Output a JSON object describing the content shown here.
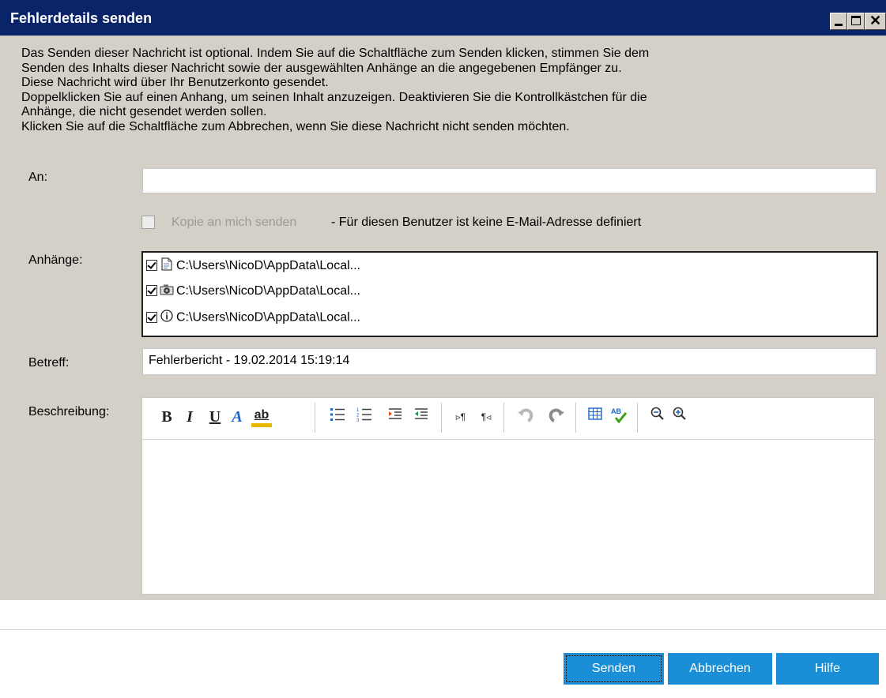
{
  "window": {
    "title": "Fehlerdetails senden",
    "minimize_icon": "minimize-icon",
    "maximize_icon": "maximize-icon",
    "close_icon": "close-icon"
  },
  "intro": {
    "line1": "Das Senden dieser Nachricht ist optional. Indem Sie auf die Schaltfläche zum Senden klicken, stimmen Sie dem",
    "line2": "Senden des Inhalts dieser Nachricht sowie der ausgewählten Anhänge an die angegebenen Empfänger zu.",
    "line3": "Diese Nachricht wird über Ihr Benutzerkonto gesendet.",
    "line4": "Doppelklicken Sie auf einen Anhang, um seinen Inhalt anzuzeigen. Deaktivieren Sie die Kontrollkästchen für die",
    "line5": "Anhänge, die nicht gesendet werden sollen.",
    "line6": "Klicken Sie auf die Schaltfläche zum Abbrechen, wenn Sie diese Nachricht nicht senden möchten."
  },
  "form": {
    "to_label": "An:",
    "to_value": "",
    "cc_label": "Kopie an mich senden",
    "cc_checked": false,
    "cc_note": "- Für diesen Benutzer ist keine E-Mail-Adresse definiert",
    "attachments_label": "Anhänge:",
    "attachments": [
      {
        "checked": true,
        "icon": "document-icon",
        "path": "C:\\Users\\NicoD\\AppData\\Local..."
      },
      {
        "checked": true,
        "icon": "camera-icon",
        "path": "C:\\Users\\NicoD\\AppData\\Local..."
      },
      {
        "checked": true,
        "icon": "info-icon",
        "path": "C:\\Users\\NicoD\\AppData\\Local..."
      }
    ],
    "subject_label": "Betreff:",
    "subject_value": "Fehlerbericht - 19.02.2014 15:19:14",
    "description_label": "Beschreibung:",
    "description_value": ""
  },
  "toolbar": {
    "bold": "B",
    "italic": "I",
    "underline": "U",
    "font_color": "A",
    "highlight": "ab",
    "icons": [
      "bullet-list-icon",
      "numbered-list-icon",
      "indent-icon",
      "outdent-icon",
      "ltr-icon",
      "rtl-icon",
      "undo-icon",
      "redo-icon",
      "table-icon",
      "spellcheck-icon",
      "zoom-out-icon",
      "zoom-in-icon"
    ]
  },
  "buttons": {
    "send": "Senden",
    "cancel": "Abbrechen",
    "help": "Hilfe"
  },
  "colors": {
    "titlebar": "#0a246a",
    "button": "#1a8fd8",
    "dialog_bg": "#d4d0c8"
  }
}
